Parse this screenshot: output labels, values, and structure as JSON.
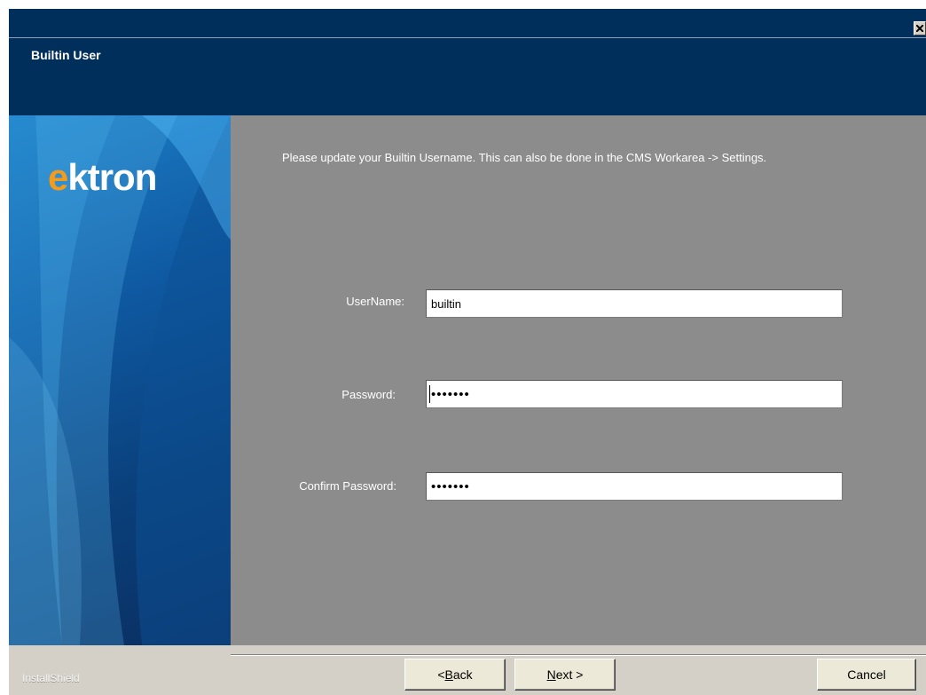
{
  "window": {
    "title": "Builtin User",
    "close_icon": "close-icon"
  },
  "banner": {
    "logo_prefix": "e",
    "logo_rest": "ktron"
  },
  "content": {
    "intro": "Please update your Builtin Username. This can also be done in the CMS Workarea -> Settings.",
    "fields": {
      "username": {
        "label": "UserName:",
        "value": "builtin"
      },
      "password": {
        "label": "Password:",
        "value": "•••••••"
      },
      "confirm_password": {
        "label": "Confirm Password:",
        "value": "•••••••"
      }
    }
  },
  "footer": {
    "brand": "InstallShield",
    "back_prefix": "< ",
    "back_accel": "B",
    "back_rest": "ack",
    "next_accel": "N",
    "next_rest": "ext >",
    "cancel": "Cancel"
  },
  "colors": {
    "header_bg": "#002f5c",
    "content_bg": "#8c8c8c",
    "logo_accent": "#f29b1d"
  }
}
